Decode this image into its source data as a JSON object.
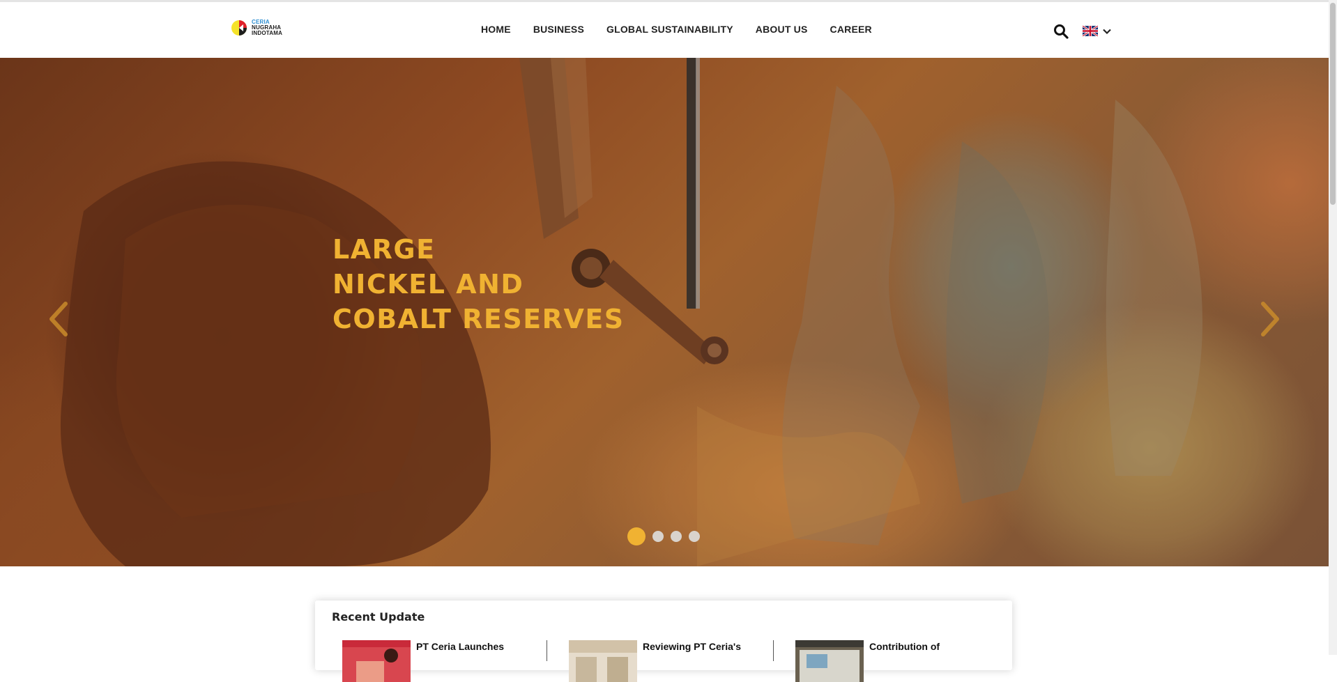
{
  "brand": {
    "line1": "CERIA",
    "line2": "NUGRAHA",
    "line3": "INDOTAMA",
    "colors": {
      "accent": "#f0b232",
      "logo_yellow": "#f5e32a",
      "logo_red": "#e0212b",
      "logo_black": "#1e1e1e",
      "logo_blue": "#2f8fd1"
    }
  },
  "nav": {
    "items": [
      {
        "label": "HOME"
      },
      {
        "label": "BUSINESS"
      },
      {
        "label": "GLOBAL SUSTAINABILITY"
      },
      {
        "label": "ABOUT US"
      },
      {
        "label": "CAREER"
      }
    ],
    "search_icon": "search-icon",
    "language": {
      "icon": "uk-flag-icon",
      "dropdown_icon": "chevron-down-icon"
    }
  },
  "hero": {
    "title_lines": [
      "LARGE",
      "NICKEL AND",
      "COBALT RESERVES"
    ],
    "prev_icon": "chevron-left-icon",
    "next_icon": "chevron-right-icon",
    "slides_total": 4,
    "active_slide": 1
  },
  "recent_update": {
    "title": "Recent Update",
    "items": [
      {
        "title": "PT Ceria Launches"
      },
      {
        "title": "Reviewing PT Ceria's"
      },
      {
        "title": "Contribution of"
      }
    ]
  }
}
